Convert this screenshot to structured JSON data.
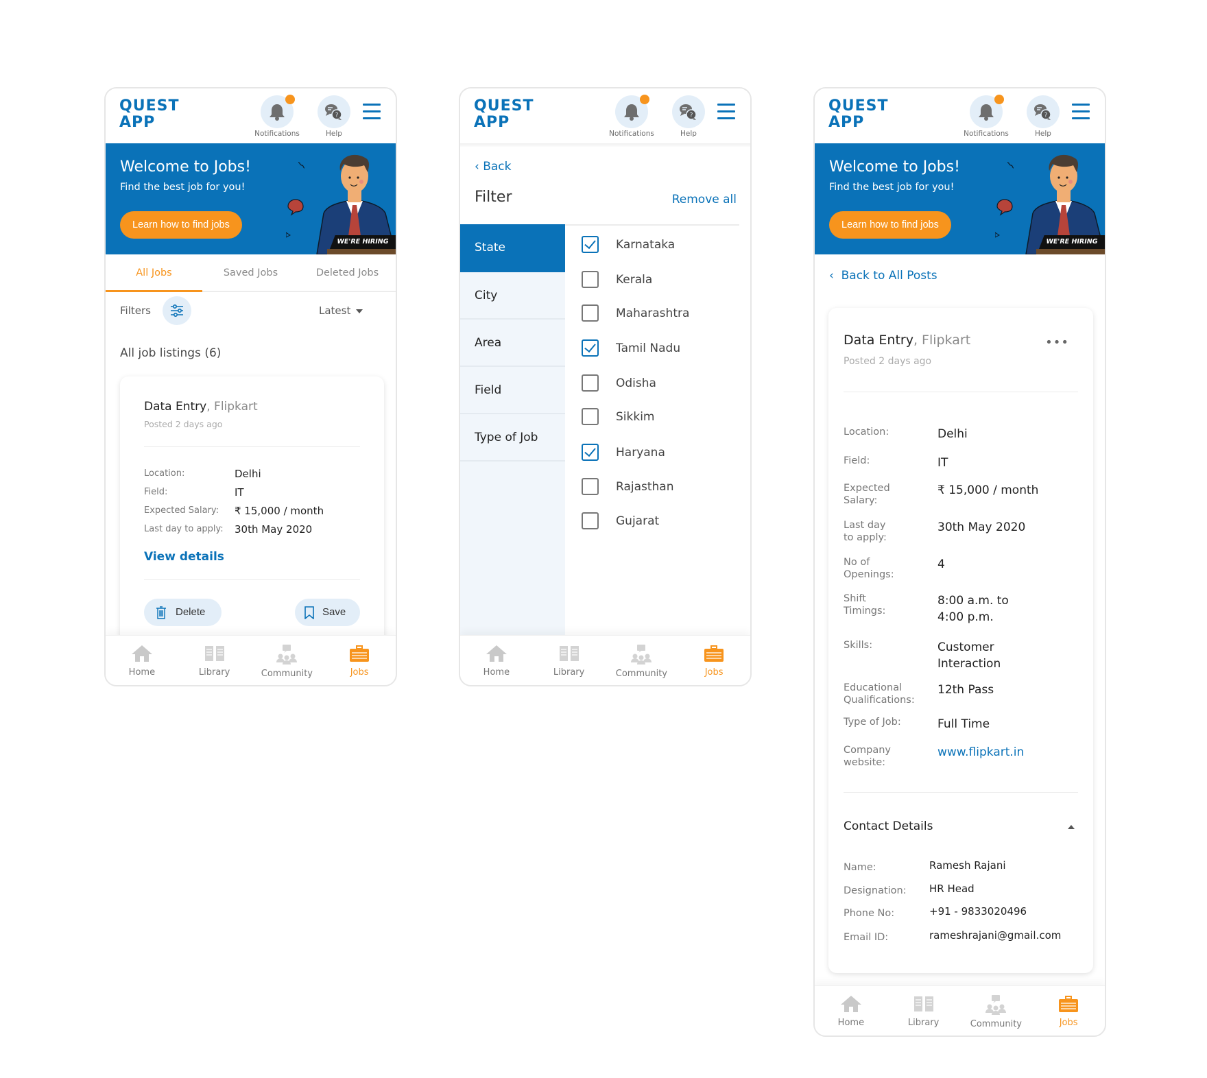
{
  "app": {
    "logo_line1": "QUEST",
    "logo_line2": "APP",
    "notifications_label": "Notifications",
    "help_label": "Help",
    "colors": {
      "primary": "#0a72b8",
      "accent": "#f7941d",
      "icon_bg": "#e3eef8"
    }
  },
  "banner": {
    "title": "Welcome to Jobs!",
    "subtitle": "Find the best job for you!",
    "cta": "Learn how to find jobs",
    "badge": "WE'RE HIRING"
  },
  "nav": {
    "items": [
      {
        "label": "Home",
        "icon": "home-icon"
      },
      {
        "label": "Library",
        "icon": "book-icon"
      },
      {
        "label": "Community",
        "icon": "community-icon"
      },
      {
        "label": "Jobs",
        "icon": "briefcase-icon",
        "active": true
      }
    ]
  },
  "screen1": {
    "tabs": [
      "All Jobs",
      "Saved Jobs",
      "Deleted Jobs"
    ],
    "active_tab": "All Jobs",
    "filters_label": "Filters",
    "sort_value": "Latest",
    "listing_count": "All job listings (6)",
    "job": {
      "title": "Data Entry",
      "company": ", Flipkart",
      "posted": "Posted 2 days ago",
      "fields": [
        {
          "label": "Location:",
          "value": "Delhi"
        },
        {
          "label": "Field:",
          "value": "IT"
        },
        {
          "label": "Expected Salary:",
          "value": "₹ 15,000 / month"
        },
        {
          "label": "Last day to apply:",
          "value": "30th May 2020"
        }
      ],
      "view_details": "View details",
      "delete_label": "Delete",
      "save_label": "Save"
    }
  },
  "screen2": {
    "back_label": "Back",
    "title": "Filter",
    "remove_all": "Remove all",
    "categories": [
      "State",
      "City",
      "Area",
      "Field",
      "Type of Job"
    ],
    "active_category": "State",
    "options": [
      {
        "label": "Karnataka",
        "checked": true
      },
      {
        "label": "Kerala",
        "checked": false
      },
      {
        "label": "Maharashtra",
        "checked": false
      },
      {
        "label": "Tamil Nadu",
        "checked": true
      },
      {
        "label": "Odisha",
        "checked": false
      },
      {
        "label": "Sikkim",
        "checked": false
      },
      {
        "label": "Haryana",
        "checked": true
      },
      {
        "label": "Rajasthan",
        "checked": false
      },
      {
        "label": "Gujarat",
        "checked": false
      }
    ]
  },
  "screen3": {
    "back_label": "Back to All Posts",
    "job": {
      "title": "Data Entry",
      "company": ", Flipkart",
      "posted": "Posted 2 days ago",
      "fields": [
        {
          "label": "Location:",
          "value": "Delhi"
        },
        {
          "label": "Field:",
          "value": "IT"
        },
        {
          "label": "Expected\nSalary:",
          "value": "₹ 15,000 / month"
        },
        {
          "label": "Last day\nto apply:",
          "value": "30th May 2020"
        },
        {
          "label": "No of\nOpenings:",
          "value": "4"
        },
        {
          "label": "Shift\nTimings:",
          "value": "8:00 a.m. to\n4:00 p.m."
        },
        {
          "label": "Skills:",
          "value": "Customer\nInteraction"
        },
        {
          "label": "Educational\nQualifications:",
          "value": "12th Pass"
        },
        {
          "label": "Type of Job:",
          "value": "Full Time"
        },
        {
          "label": "Company\nwebsite:",
          "value": "www.flipkart.in"
        }
      ]
    },
    "contact": {
      "title": "Contact Details",
      "fields": [
        {
          "label": "Name:",
          "value": "Ramesh Rajani"
        },
        {
          "label": "Designation:",
          "value": "HR Head"
        },
        {
          "label": "Phone No:",
          "value": "+91 - 9833020496"
        },
        {
          "label": "Email ID:",
          "value": "rameshrajani@gmail.com"
        }
      ]
    }
  }
}
